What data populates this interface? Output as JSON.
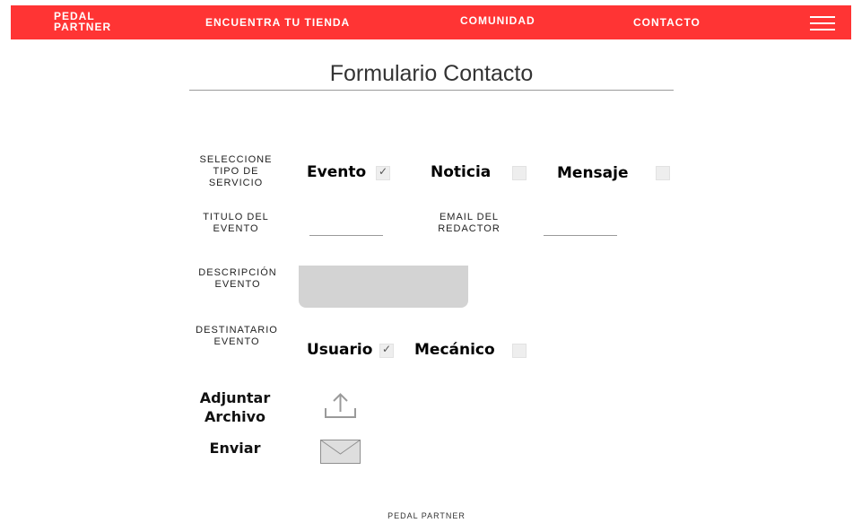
{
  "header": {
    "brand": "PEDAL PARTNER",
    "nav": [
      "ENCUENTRA TU TIENDA",
      "COMUNIDAD",
      "CONTACTO"
    ],
    "menu_icon": "hamburger-menu-icon",
    "color": "#ff3434"
  },
  "form": {
    "title": "Formulario Contacto",
    "service_label": "SELECCIONE TIPO DE SERVICIO",
    "service_options": [
      {
        "label": "Evento",
        "checked": true
      },
      {
        "label": "Noticia",
        "checked": false
      },
      {
        "label": "Mensaje",
        "checked": false
      }
    ],
    "event_title_label": "TITULO DEL EVENTO",
    "event_title_value": "",
    "editor_email_label": "EMAIL DEL REDACTOR",
    "editor_email_value": "",
    "description_label": "DESCRIPCIÓN EVENTO",
    "description_value": "",
    "recipient_label": "DESTINATARIO EVENTO",
    "recipient_options": [
      {
        "label": "Usuario",
        "checked": true
      },
      {
        "label": "Mecánico",
        "checked": false
      }
    ],
    "attach_label": "Adjuntar Archivo",
    "attach_icon": "upload-icon",
    "send_label": "Enviar",
    "send_icon": "envelope-icon"
  },
  "footer": {
    "text": "PEDAL PARTNER"
  }
}
